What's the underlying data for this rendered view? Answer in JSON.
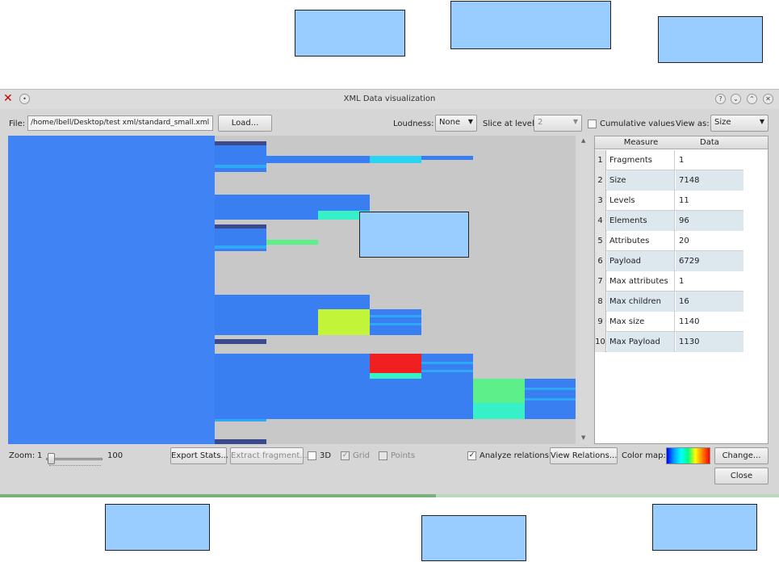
{
  "window": {
    "title": "XML Data visualization"
  },
  "toolbar": {
    "file_label": "File:",
    "file_path": "/home/lbell/Desktop/test xml/standard_small.xml",
    "load_label": "Load...",
    "loudness_label": "Loudness:",
    "loudness_value": "None",
    "slice_label": "Slice at level:",
    "slice_value": "2",
    "cumulative_label": "Cumulative values",
    "viewas_label": "View as:",
    "viewas_value": "Size"
  },
  "table": {
    "columns": [
      "Measure",
      "Data"
    ],
    "rows": [
      {
        "num": "1",
        "measure": "Fragments",
        "data": "1"
      },
      {
        "num": "2",
        "measure": "Size",
        "data": "7148"
      },
      {
        "num": "3",
        "measure": "Levels",
        "data": "11"
      },
      {
        "num": "4",
        "measure": "Elements",
        "data": "96"
      },
      {
        "num": "5",
        "measure": "Attributes",
        "data": "20"
      },
      {
        "num": "6",
        "measure": "Payload",
        "data": "6729"
      },
      {
        "num": "7",
        "measure": "Max attributes",
        "data": "1"
      },
      {
        "num": "8",
        "measure": "Max children",
        "data": "16"
      },
      {
        "num": "9",
        "measure": "Max size",
        "data": "1140"
      },
      {
        "num": "10",
        "measure": "Max Payload",
        "data": "1130"
      }
    ]
  },
  "bottom": {
    "zoom_label": "Zoom:",
    "zoom_min": "1",
    "zoom_max": "100",
    "export_label": "Export Stats...",
    "extract_label": "Extract fragment...",
    "threed_label": "3D",
    "grid_label": "Grid",
    "points_label": "Points",
    "analyze_label": "Analyze relations",
    "view_relations_label": "View Relations...",
    "colormap_label": "Color map:",
    "change_label": "Change...",
    "close_label": "Close"
  },
  "colors": {
    "base_blue": "#3f83f5",
    "dark_navy": "#3a4a8c",
    "cyan": "#2ad4f0",
    "teal": "#36f0c8",
    "green": "#5df08a",
    "yellow_green": "#c2f53a",
    "red": "#f02020"
  }
}
